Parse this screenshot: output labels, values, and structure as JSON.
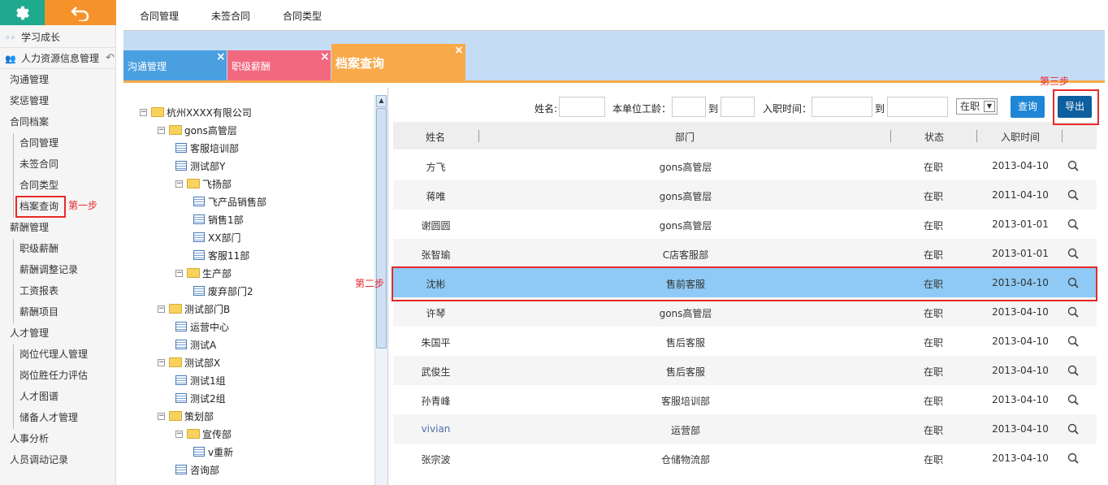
{
  "sidebar": {
    "items": [
      {
        "label": "学习成长",
        "icon": "glasses-icon",
        "level": "top"
      },
      {
        "label": "人力资源信息管理",
        "icon": "users-icon",
        "level": "top"
      },
      {
        "label": "沟通管理",
        "level": "group"
      },
      {
        "label": "奖惩管理",
        "level": "group"
      },
      {
        "label": "合同档案",
        "level": "group"
      },
      {
        "label": "合同管理",
        "level": "sub"
      },
      {
        "label": "未签合同",
        "level": "sub"
      },
      {
        "label": "合同类型",
        "level": "sub"
      },
      {
        "label": "档案查询",
        "level": "sub"
      },
      {
        "label": "薪酬管理",
        "level": "group"
      },
      {
        "label": "职级薪酬",
        "level": "sub"
      },
      {
        "label": "薪酬调整记录",
        "level": "sub"
      },
      {
        "label": "工资报表",
        "level": "sub"
      },
      {
        "label": "薪酬项目",
        "level": "sub"
      },
      {
        "label": "人才管理",
        "level": "group"
      },
      {
        "label": "岗位代理人管理",
        "level": "sub"
      },
      {
        "label": "岗位胜任力评估",
        "level": "sub"
      },
      {
        "label": "人才图谱",
        "level": "sub"
      },
      {
        "label": "储备人才管理",
        "level": "sub"
      },
      {
        "label": "人事分析",
        "level": "group"
      },
      {
        "label": "人员调动记录",
        "level": "group"
      }
    ]
  },
  "annotations": {
    "step1": "第一步",
    "step2": "第二步",
    "step3": "第三步"
  },
  "topnav": [
    "合同管理",
    "未签合同",
    "合同类型"
  ],
  "tabs": [
    {
      "label": "沟通管理",
      "color": "#4a9fe0"
    },
    {
      "label": "职级薪酬",
      "color": "#f2687f"
    },
    {
      "label": "档案查询",
      "color": "#f8a94a",
      "active": true
    }
  ],
  "tree": [
    {
      "label": "杭州XXXX有限公司",
      "type": "folder",
      "toggle": "−"
    },
    {
      "label": "gons高管层",
      "type": "folder",
      "toggle": "−"
    },
    {
      "label": "客服培训部",
      "type": "table"
    },
    {
      "label": "测试部Y",
      "type": "table"
    },
    {
      "label": "飞扬部",
      "type": "folder",
      "toggle": "−"
    },
    {
      "label": "飞产品销售部",
      "type": "table"
    },
    {
      "label": "销售1部",
      "type": "table"
    },
    {
      "label": "XX部门",
      "type": "table"
    },
    {
      "label": "客服11部",
      "type": "table"
    },
    {
      "label": "生产部",
      "type": "folder",
      "toggle": "−"
    },
    {
      "label": "废弃部门2",
      "type": "table"
    },
    {
      "label": "测试部门B",
      "type": "folder",
      "toggle": "−"
    },
    {
      "label": "运营中心",
      "type": "table"
    },
    {
      "label": "测试A",
      "type": "table"
    },
    {
      "label": "测试部X",
      "type": "folder",
      "toggle": "−"
    },
    {
      "label": "测试1组",
      "type": "table"
    },
    {
      "label": "测试2组",
      "type": "table"
    },
    {
      "label": "策划部",
      "type": "folder",
      "toggle": "−"
    },
    {
      "label": "宣传部",
      "type": "folder",
      "toggle": "−"
    },
    {
      "label": "v重新",
      "type": "table"
    },
    {
      "label": "咨询部",
      "type": "table"
    }
  ],
  "filters": {
    "name_label": "姓名:",
    "tenure_label": "本单位工龄：",
    "to1": "到",
    "date_label": "入职时间：",
    "to2": "到",
    "status_value": "在职",
    "search_btn": "查询",
    "export_btn": "导出"
  },
  "table": {
    "headers": [
      "姓名",
      "部门",
      "状态",
      "入职时间"
    ],
    "rows": [
      {
        "name": "方飞",
        "dept": "gons高管层",
        "status": "在职",
        "date": "2013-04-10"
      },
      {
        "name": "蒋唯",
        "dept": "gons高管层",
        "status": "在职",
        "date": "2011-04-10"
      },
      {
        "name": "谢圆圆",
        "dept": "gons高管层",
        "status": "在职",
        "date": "2013-01-01"
      },
      {
        "name": "张智瑜",
        "dept": "C店客服部",
        "status": "在职",
        "date": "2013-01-01"
      },
      {
        "name": "沈彬",
        "dept": "售前客服",
        "status": "在职",
        "date": "2013-04-10",
        "selected": true
      },
      {
        "name": "许琴",
        "dept": "gons高管层",
        "status": "在职",
        "date": "2013-04-10"
      },
      {
        "name": "朱国平",
        "dept": "售后客服",
        "status": "在职",
        "date": "2013-04-10"
      },
      {
        "name": "武俊生",
        "dept": "售后客服",
        "status": "在职",
        "date": "2013-04-10"
      },
      {
        "name": "孙青峰",
        "dept": "客服培训部",
        "status": "在职",
        "date": "2013-04-10"
      },
      {
        "name": "vivian",
        "dept": "运营部",
        "status": "在职",
        "date": "2013-04-10"
      },
      {
        "name": "张宗波",
        "dept": "仓储物流部",
        "status": "在职",
        "date": "2013-04-10"
      }
    ]
  }
}
